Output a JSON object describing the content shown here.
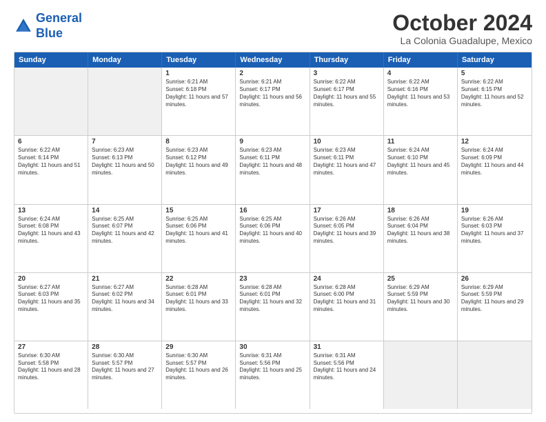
{
  "logo": {
    "line1": "General",
    "line2": "Blue"
  },
  "title": "October 2024",
  "subtitle": "La Colonia Guadalupe, Mexico",
  "header_days": [
    "Sunday",
    "Monday",
    "Tuesday",
    "Wednesday",
    "Thursday",
    "Friday",
    "Saturday"
  ],
  "weeks": [
    [
      {
        "day": "",
        "text": "",
        "shaded": true
      },
      {
        "day": "",
        "text": "",
        "shaded": true
      },
      {
        "day": "1",
        "text": "Sunrise: 6:21 AM\nSunset: 6:18 PM\nDaylight: 11 hours and 57 minutes.",
        "shaded": false
      },
      {
        "day": "2",
        "text": "Sunrise: 6:21 AM\nSunset: 6:17 PM\nDaylight: 11 hours and 56 minutes.",
        "shaded": false
      },
      {
        "day": "3",
        "text": "Sunrise: 6:22 AM\nSunset: 6:17 PM\nDaylight: 11 hours and 55 minutes.",
        "shaded": false
      },
      {
        "day": "4",
        "text": "Sunrise: 6:22 AM\nSunset: 6:16 PM\nDaylight: 11 hours and 53 minutes.",
        "shaded": false
      },
      {
        "day": "5",
        "text": "Sunrise: 6:22 AM\nSunset: 6:15 PM\nDaylight: 11 hours and 52 minutes.",
        "shaded": false
      }
    ],
    [
      {
        "day": "6",
        "text": "Sunrise: 6:22 AM\nSunset: 6:14 PM\nDaylight: 11 hours and 51 minutes.",
        "shaded": false
      },
      {
        "day": "7",
        "text": "Sunrise: 6:23 AM\nSunset: 6:13 PM\nDaylight: 11 hours and 50 minutes.",
        "shaded": false
      },
      {
        "day": "8",
        "text": "Sunrise: 6:23 AM\nSunset: 6:12 PM\nDaylight: 11 hours and 49 minutes.",
        "shaded": false
      },
      {
        "day": "9",
        "text": "Sunrise: 6:23 AM\nSunset: 6:11 PM\nDaylight: 11 hours and 48 minutes.",
        "shaded": false
      },
      {
        "day": "10",
        "text": "Sunrise: 6:23 AM\nSunset: 6:11 PM\nDaylight: 11 hours and 47 minutes.",
        "shaded": false
      },
      {
        "day": "11",
        "text": "Sunrise: 6:24 AM\nSunset: 6:10 PM\nDaylight: 11 hours and 45 minutes.",
        "shaded": false
      },
      {
        "day": "12",
        "text": "Sunrise: 6:24 AM\nSunset: 6:09 PM\nDaylight: 11 hours and 44 minutes.",
        "shaded": false
      }
    ],
    [
      {
        "day": "13",
        "text": "Sunrise: 6:24 AM\nSunset: 6:08 PM\nDaylight: 11 hours and 43 minutes.",
        "shaded": false
      },
      {
        "day": "14",
        "text": "Sunrise: 6:25 AM\nSunset: 6:07 PM\nDaylight: 11 hours and 42 minutes.",
        "shaded": false
      },
      {
        "day": "15",
        "text": "Sunrise: 6:25 AM\nSunset: 6:06 PM\nDaylight: 11 hours and 41 minutes.",
        "shaded": false
      },
      {
        "day": "16",
        "text": "Sunrise: 6:25 AM\nSunset: 6:06 PM\nDaylight: 11 hours and 40 minutes.",
        "shaded": false
      },
      {
        "day": "17",
        "text": "Sunrise: 6:26 AM\nSunset: 6:05 PM\nDaylight: 11 hours and 39 minutes.",
        "shaded": false
      },
      {
        "day": "18",
        "text": "Sunrise: 6:26 AM\nSunset: 6:04 PM\nDaylight: 11 hours and 38 minutes.",
        "shaded": false
      },
      {
        "day": "19",
        "text": "Sunrise: 6:26 AM\nSunset: 6:03 PM\nDaylight: 11 hours and 37 minutes.",
        "shaded": false
      }
    ],
    [
      {
        "day": "20",
        "text": "Sunrise: 6:27 AM\nSunset: 6:03 PM\nDaylight: 11 hours and 35 minutes.",
        "shaded": false
      },
      {
        "day": "21",
        "text": "Sunrise: 6:27 AM\nSunset: 6:02 PM\nDaylight: 11 hours and 34 minutes.",
        "shaded": false
      },
      {
        "day": "22",
        "text": "Sunrise: 6:28 AM\nSunset: 6:01 PM\nDaylight: 11 hours and 33 minutes.",
        "shaded": false
      },
      {
        "day": "23",
        "text": "Sunrise: 6:28 AM\nSunset: 6:01 PM\nDaylight: 11 hours and 32 minutes.",
        "shaded": false
      },
      {
        "day": "24",
        "text": "Sunrise: 6:28 AM\nSunset: 6:00 PM\nDaylight: 11 hours and 31 minutes.",
        "shaded": false
      },
      {
        "day": "25",
        "text": "Sunrise: 6:29 AM\nSunset: 5:59 PM\nDaylight: 11 hours and 30 minutes.",
        "shaded": false
      },
      {
        "day": "26",
        "text": "Sunrise: 6:29 AM\nSunset: 5:59 PM\nDaylight: 11 hours and 29 minutes.",
        "shaded": false
      }
    ],
    [
      {
        "day": "27",
        "text": "Sunrise: 6:30 AM\nSunset: 5:58 PM\nDaylight: 11 hours and 28 minutes.",
        "shaded": false
      },
      {
        "day": "28",
        "text": "Sunrise: 6:30 AM\nSunset: 5:57 PM\nDaylight: 11 hours and 27 minutes.",
        "shaded": false
      },
      {
        "day": "29",
        "text": "Sunrise: 6:30 AM\nSunset: 5:57 PM\nDaylight: 11 hours and 26 minutes.",
        "shaded": false
      },
      {
        "day": "30",
        "text": "Sunrise: 6:31 AM\nSunset: 5:56 PM\nDaylight: 11 hours and 25 minutes.",
        "shaded": false
      },
      {
        "day": "31",
        "text": "Sunrise: 6:31 AM\nSunset: 5:56 PM\nDaylight: 11 hours and 24 minutes.",
        "shaded": false
      },
      {
        "day": "",
        "text": "",
        "shaded": true
      },
      {
        "day": "",
        "text": "",
        "shaded": true
      }
    ]
  ]
}
